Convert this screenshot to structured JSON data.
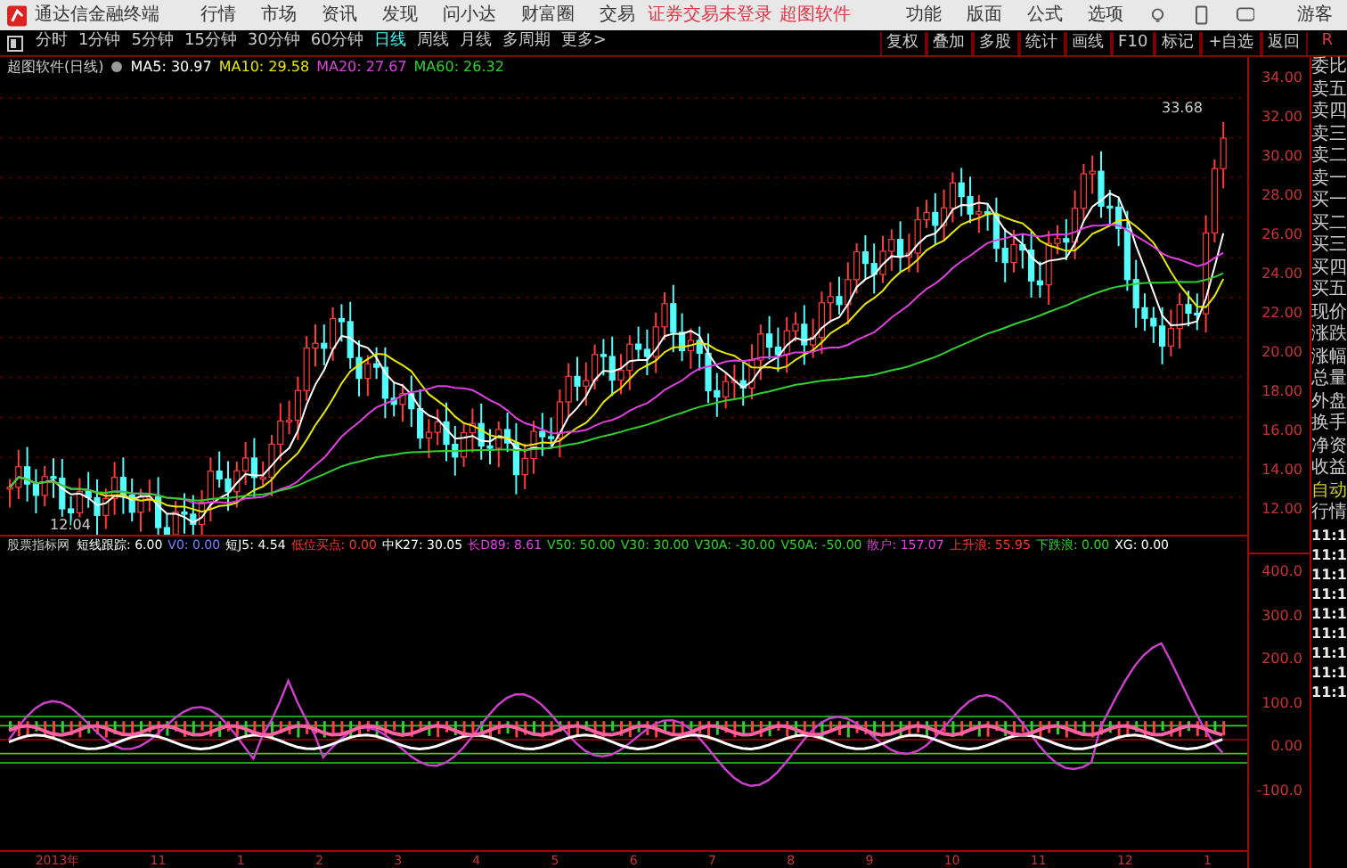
{
  "app": {
    "title": "通达信金融终端"
  },
  "menu": [
    "行情",
    "市场",
    "资讯",
    "发现",
    "问小达",
    "财富圈",
    "交易"
  ],
  "login_status": "证券交易未登录",
  "brand_link": "超图软件",
  "tools": [
    "功能",
    "版面",
    "公式",
    "选项"
  ],
  "user": "游客",
  "periods": [
    {
      "label": "分时",
      "selected": false
    },
    {
      "label": "1分钟",
      "selected": false
    },
    {
      "label": "5分钟",
      "selected": false
    },
    {
      "label": "15分钟",
      "selected": false
    },
    {
      "label": "30分钟",
      "selected": false
    },
    {
      "label": "60分钟",
      "selected": false
    },
    {
      "label": "日线",
      "selected": true
    },
    {
      "label": "周线",
      "selected": false
    },
    {
      "label": "月线",
      "selected": false
    },
    {
      "label": "多周期",
      "selected": false
    },
    {
      "label": "更多>",
      "selected": false
    }
  ],
  "actions": [
    "复权",
    "叠加",
    "多股",
    "统计",
    "画线",
    "F10",
    "标记",
    "+自选",
    "返回"
  ],
  "corner_badge": "R",
  "chart": {
    "title": "超图软件(日线)",
    "ma": [
      {
        "label": "MA5: 30.97",
        "color": "#ffffff"
      },
      {
        "label": "MA10: 29.58",
        "color": "#e8e800"
      },
      {
        "label": "MA20: 27.67",
        "color": "#e040e0"
      },
      {
        "label": "MA60: 26.32",
        "color": "#30d030"
      }
    ],
    "high_mark": "33.68",
    "low_mark": "12.04",
    "price_labels": [
      "34.00",
      "32.00",
      "30.00",
      "28.00",
      "26.00",
      "24.00",
      "22.00",
      "20.00",
      "18.00",
      "16.00",
      "14.00",
      "12.00"
    ]
  },
  "indicator": {
    "name": "股票指标网",
    "values": [
      {
        "label": "短线跟踪: 6.00",
        "color": "#ffffff"
      },
      {
        "label": "V0: 0.00",
        "color": "#8080ff"
      },
      {
        "label": "短J5: 4.54",
        "color": "#ffffff"
      },
      {
        "label": "低位买点: 0.00",
        "color": "#ff3030"
      },
      {
        "label": "中K27: 30.05",
        "color": "#ffffff"
      },
      {
        "label": "长D89: 8.61",
        "color": "#e040e0"
      },
      {
        "label": "V50: 50.00",
        "color": "#30d030"
      },
      {
        "label": "V30: 30.00",
        "color": "#30d030"
      },
      {
        "label": "V30A: -30.00",
        "color": "#30d030"
      },
      {
        "label": "V50A: -50.00",
        "color": "#30d030"
      },
      {
        "label": "散户: 157.07",
        "color": "#e040e0"
      },
      {
        "label": "上升浪: 55.95",
        "color": "#ff3030"
      },
      {
        "label": "下跌浪: 0.00",
        "color": "#30d030"
      },
      {
        "label": "XG: 0.00",
        "color": "#ffffff"
      }
    ],
    "axis_labels": [
      "400.0",
      "300.0",
      "200.0",
      "100.0",
      "0.00",
      "-100.0"
    ]
  },
  "date_axis": [
    "2013年",
    "11",
    "1",
    "2",
    "3",
    "4",
    "5",
    "6",
    "7",
    "8",
    "9",
    "10",
    "11",
    "12",
    "1"
  ],
  "quote_panel": {
    "fields": [
      "委比",
      "卖五",
      "卖四",
      "卖三",
      "卖二",
      "卖一",
      "买一",
      "买二",
      "买三",
      "买四",
      "买五",
      "现价",
      "涨跌",
      "涨幅",
      "总量",
      "外盘",
      "换手",
      "净资",
      "收益"
    ],
    "mode": [
      "自动",
      "行情"
    ],
    "times": [
      "11:1",
      "11:1",
      "11:1",
      "11:1",
      "11:1",
      "11:1",
      "11:1",
      "11:1",
      "11:1"
    ]
  }
}
